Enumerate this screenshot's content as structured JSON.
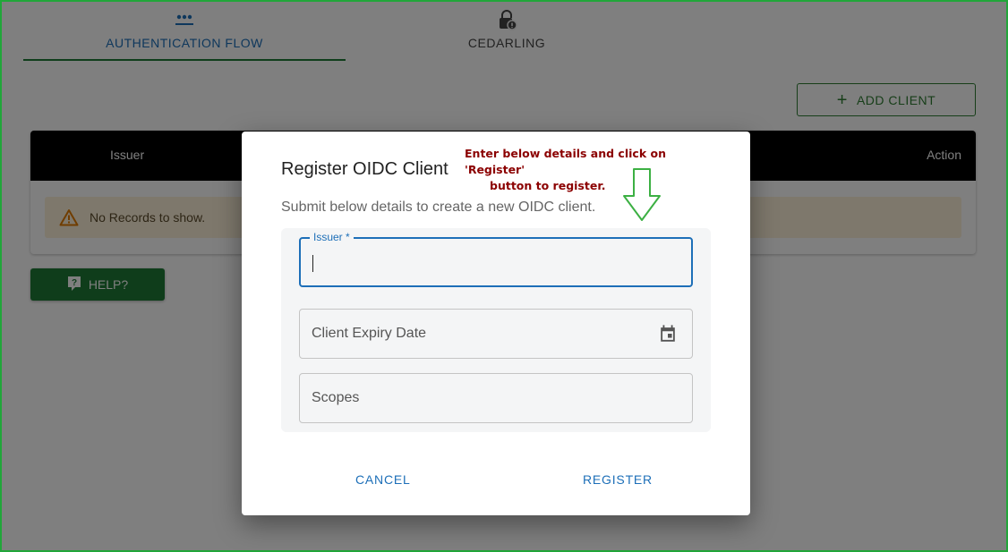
{
  "tabs": [
    {
      "label": "AUTHENTICATION FLOW",
      "icon": "dots-icon",
      "active": true
    },
    {
      "label": "CEDARLING",
      "icon": "lock-icon",
      "active": false
    }
  ],
  "toolbar": {
    "add_client_label": "ADD CLIENT"
  },
  "table": {
    "columns": {
      "issuer": "Issuer",
      "action": "Action"
    },
    "empty_message": "No Records to show."
  },
  "help": {
    "label": "HELP?"
  },
  "dialog": {
    "title": "Register OIDC Client",
    "subtitle": "Submit below details to create a new OIDC client.",
    "annotation_line1": "Enter below details and click on 'Register'",
    "annotation_line2": "button to register.",
    "fields": {
      "issuer": {
        "label": "Issuer *",
        "value": ""
      },
      "expiry": {
        "placeholder": "Client Expiry Date"
      },
      "scopes": {
        "placeholder": "Scopes"
      }
    },
    "cancel_label": "CANCEL",
    "register_label": "REGISTER"
  },
  "colors": {
    "primary": "#1d6fb8",
    "success": "#1f7a36",
    "annotation": "#8b0000",
    "frame": "#21a63a"
  }
}
